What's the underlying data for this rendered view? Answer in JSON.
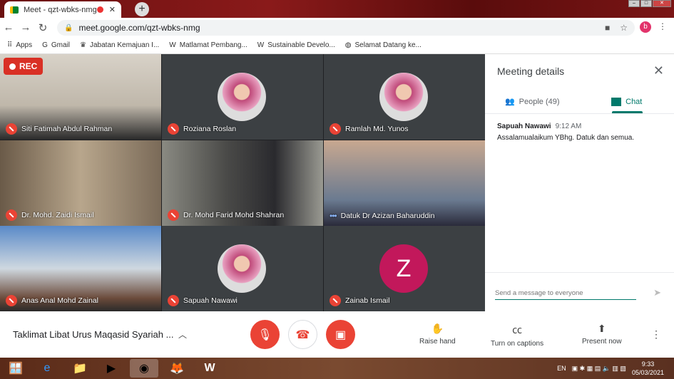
{
  "browser": {
    "tab_title": "Meet - qzt-wbks-nmg",
    "url": "meet.google.com/qzt-wbks-nmg",
    "profile_initial": "b",
    "bookmarks": [
      {
        "label": "Apps",
        "icon": "apps-grid-icon"
      },
      {
        "label": "Gmail",
        "icon": "google-icon"
      },
      {
        "label": "Jabatan Kemajuan I...",
        "icon": "crest-icon"
      },
      {
        "label": "Matlamat Pembang...",
        "icon": "wikipedia-icon"
      },
      {
        "label": "Sustainable Develo...",
        "icon": "wikipedia-icon"
      },
      {
        "label": "Selamat Datang ke...",
        "icon": "globe-icon"
      }
    ]
  },
  "recording": {
    "label": "REC"
  },
  "participants": [
    {
      "name": "Siti Fatimah Abdul Rahman",
      "muted": true,
      "video": true
    },
    {
      "name": "Roziana Roslan",
      "muted": true,
      "video": false
    },
    {
      "name": "Ramlah Md. Yunos",
      "muted": true,
      "video": false
    },
    {
      "name": "Dr. Mohd. Zaidi Ismail",
      "muted": true,
      "video": true
    },
    {
      "name": "Dr. Mohd Farid Mohd Shahran",
      "muted": true,
      "video": true
    },
    {
      "name": "Datuk Dr Azizan Baharuddin",
      "muted": false,
      "speaking": true,
      "video": true
    },
    {
      "name": "Anas Anal Mohd Zainal",
      "muted": true,
      "video": true
    },
    {
      "name": "Sapuah Nawawi",
      "muted": true,
      "video": false
    },
    {
      "name": "Zainab Ismail",
      "muted": true,
      "video": false,
      "initial": "Z",
      "avatar_color": "#c2185b"
    }
  ],
  "panel": {
    "title": "Meeting details",
    "people_tab": "People (49)",
    "chat_tab": "Chat",
    "messages": [
      {
        "sender": "Sapuah Nawawi",
        "time": "9:12 AM",
        "text": "Assalamualaikum YBhg. Datuk dan semua."
      }
    ],
    "compose_placeholder": "Send a message to everyone"
  },
  "controls": {
    "meeting_title": "Taklimat Libat Urus Maqasid Syariah ...",
    "raise_hand": "Raise hand",
    "captions": "Turn on captions",
    "present": "Present now"
  },
  "taskbar": {
    "language": "EN",
    "time": "9:33",
    "date": "05/03/2021"
  },
  "colors": {
    "accent": "#00796b",
    "danger": "#ea4335"
  }
}
